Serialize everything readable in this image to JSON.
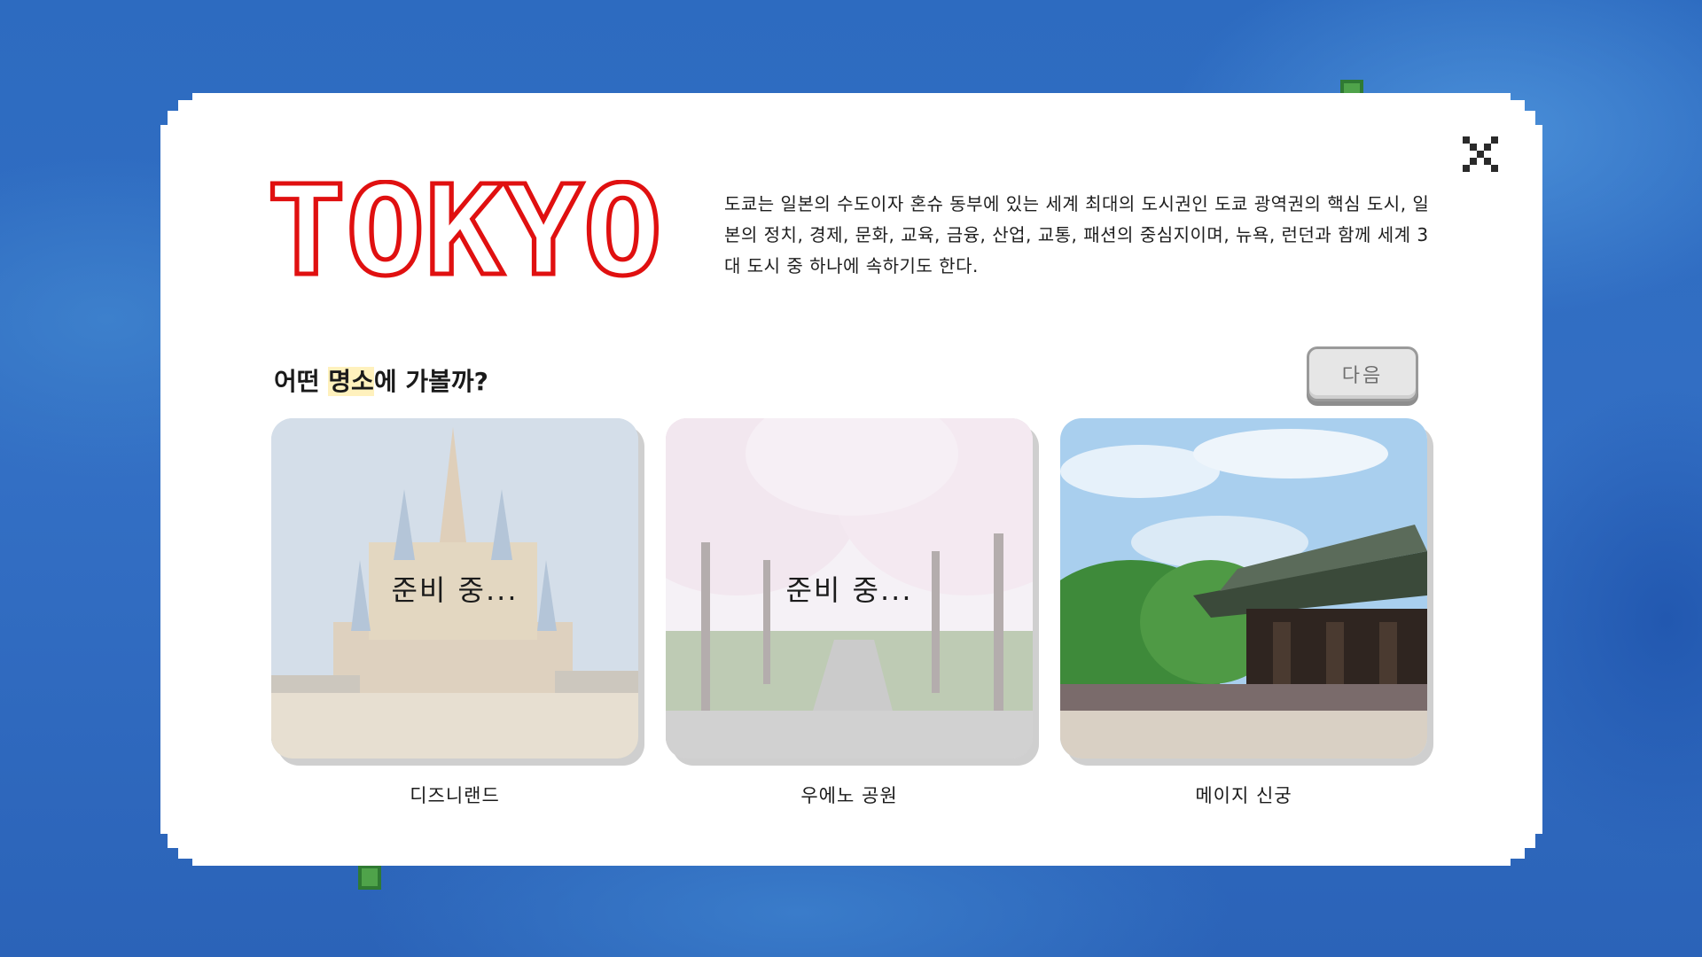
{
  "modal": {
    "title": "TOKYO",
    "description": "도쿄는 일본의 수도이자 혼슈 동부에 있는 세계 최대의 도시권인 도쿄 광역권의 핵심 도시, 일본의 정치, 경제, 문화, 교육, 금융, 산업, 교통, 패션의 중심지이며, 뉴욕, 런던과 함께 세계 3대 도시 중 하나에 속하기도 한다.",
    "question_before": "어떤 ",
    "question_highlight": "명소",
    "question_after": "에 가볼까?",
    "next_label": "다음",
    "close_icon": "close-icon"
  },
  "places": [
    {
      "label": "디즈니랜드",
      "status": "준비 중...",
      "locked": true
    },
    {
      "label": "우에노 공원",
      "status": "준비 중...",
      "locked": true
    },
    {
      "label": "메이지 신궁",
      "status": "",
      "locked": false
    }
  ],
  "colors": {
    "ocean": "#2f6ec0",
    "title_red": "#e01010",
    "highlight": "#fff1bd",
    "button_gray": "#e6e6e6"
  }
}
